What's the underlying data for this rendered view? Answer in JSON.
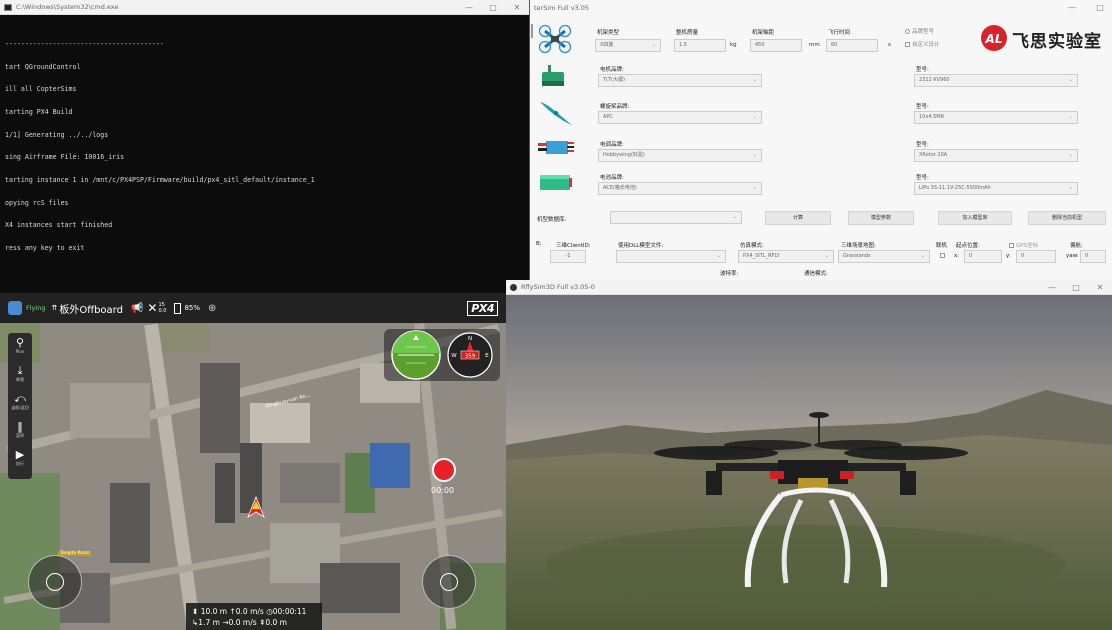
{
  "console": {
    "title": "C:\\Windows\\System32\\cmd.exe",
    "lines": [
      "----------------------------------------",
      "tart QGroundControl",
      "ill all CopterSims",
      "tarting PX4 Build",
      "1/1] Generating ../../logs",
      "sing Airframe File: 10016_iris",
      "tarting instance 1 in /mnt/c/PX4PSP/Firmware/build/px4_sitl_default/instance_1",
      "opying rcS files",
      "X4 instances start finished",
      "ress any key to exit"
    ],
    "controls": {
      "minimize": "—",
      "maximize": "□",
      "close": "✕"
    }
  },
  "config": {
    "title": "terSim Full v3.05",
    "controls": {
      "minimize": "—",
      "maximize": "□"
    },
    "labels": {
      "frame_type": "机架类型",
      "total_mass": "整机质量",
      "wheelbase": "机架轴距",
      "flight_time": "飞行时间",
      "preset": "品牌型号",
      "custom": "自定义设计",
      "motor_brand": "电机品牌:",
      "prop_brand": "螺旋桨品牌:",
      "esc_brand": "电调品牌:",
      "battery_brand": "电池品牌:",
      "model_label": "型号:",
      "model_db": "机型数据库:",
      "dll_file": "使用DLL模型文件:",
      "sim_mode": "仿真模式:",
      "scene_map": "三维场景地图:",
      "clientid": "三维ClientID:",
      "link": "联机",
      "start_pos": "起点位置:",
      "gps_coord": "GPS坐标",
      "yaw": "偏航:",
      "baud": "波特率:",
      "comm_mode": "通信模式:",
      "frame_prefix": "B:"
    },
    "values": {
      "frame_type": "X四旋",
      "total_mass": "1.5",
      "mass_unit": "kg",
      "wheelbase": "450",
      "wheelbase_unit": "mm",
      "flight_time": "60",
      "time_unit": "s",
      "motor_brand": "T(T(大疆)",
      "motor_model": "2312 KV960",
      "prop_brand": "APC",
      "prop_model": "10x4.5MR",
      "esc_brand": "Hobbywing(好盈)",
      "esc_model": "XRotor 20A",
      "battery_brand": "ACE(格氏电池)",
      "battery_model": "LiPo 3S-11.1V-25C-5500mAh",
      "clientid": "-1",
      "sim_mode": "PX4_SITL_RFLY",
      "scene_map": "Grasslands",
      "x": "0",
      "y": "0",
      "yaw": "0",
      "x_label": "x:",
      "y_label": "y:",
      "yaw_label": "yaw:"
    },
    "buttons": {
      "compute": "计算",
      "model_params": "模型参数",
      "add_model": "加入模型库",
      "delete_model": "删除当前机型"
    },
    "logo_text": "飞思实验室",
    "logo_mark": "AL"
  },
  "qgc": {
    "flight_state": "Flying",
    "flight_mode": "板外Offboard",
    "gps_count": "15",
    "gps_hdop": "0.0",
    "battery": "85%",
    "logo": "PX4",
    "tools": [
      {
        "label": "Plan",
        "icon": "plan-icon"
      },
      {
        "label": "降落",
        "icon": "land-icon"
      },
      {
        "label": "返航/返回",
        "icon": "rtl-icon"
      },
      {
        "label": "暂停",
        "icon": "pause-icon"
      },
      {
        "label": "执行",
        "icon": "play-icon"
      }
    ],
    "record_time": "00:00",
    "telemetry": {
      "alt": "10.0 m",
      "vspeed": "0.0 m/s",
      "time": "00:00:11",
      "dist": "1.7 m",
      "hspeed": "0.0 m/s",
      "dist2": "0.0 m"
    },
    "compass_heading": "359",
    "compass_n": "N",
    "compass_w": "W",
    "compass_e": "E",
    "map_label": "Qinghuayuan Ro...",
    "map_label2": "Tongda Road"
  },
  "rfly": {
    "title": "RflySim3D Full v3.05-0",
    "controls": {
      "minimize": "—",
      "maximize": "□",
      "close": "✕"
    }
  },
  "colors": {
    "console_bg": "#0c0c0c",
    "qgc_bar": "#222222",
    "record_red": "#e8202a",
    "logo_red": "#d9232a",
    "horizon_green": "#5c9f2a"
  }
}
